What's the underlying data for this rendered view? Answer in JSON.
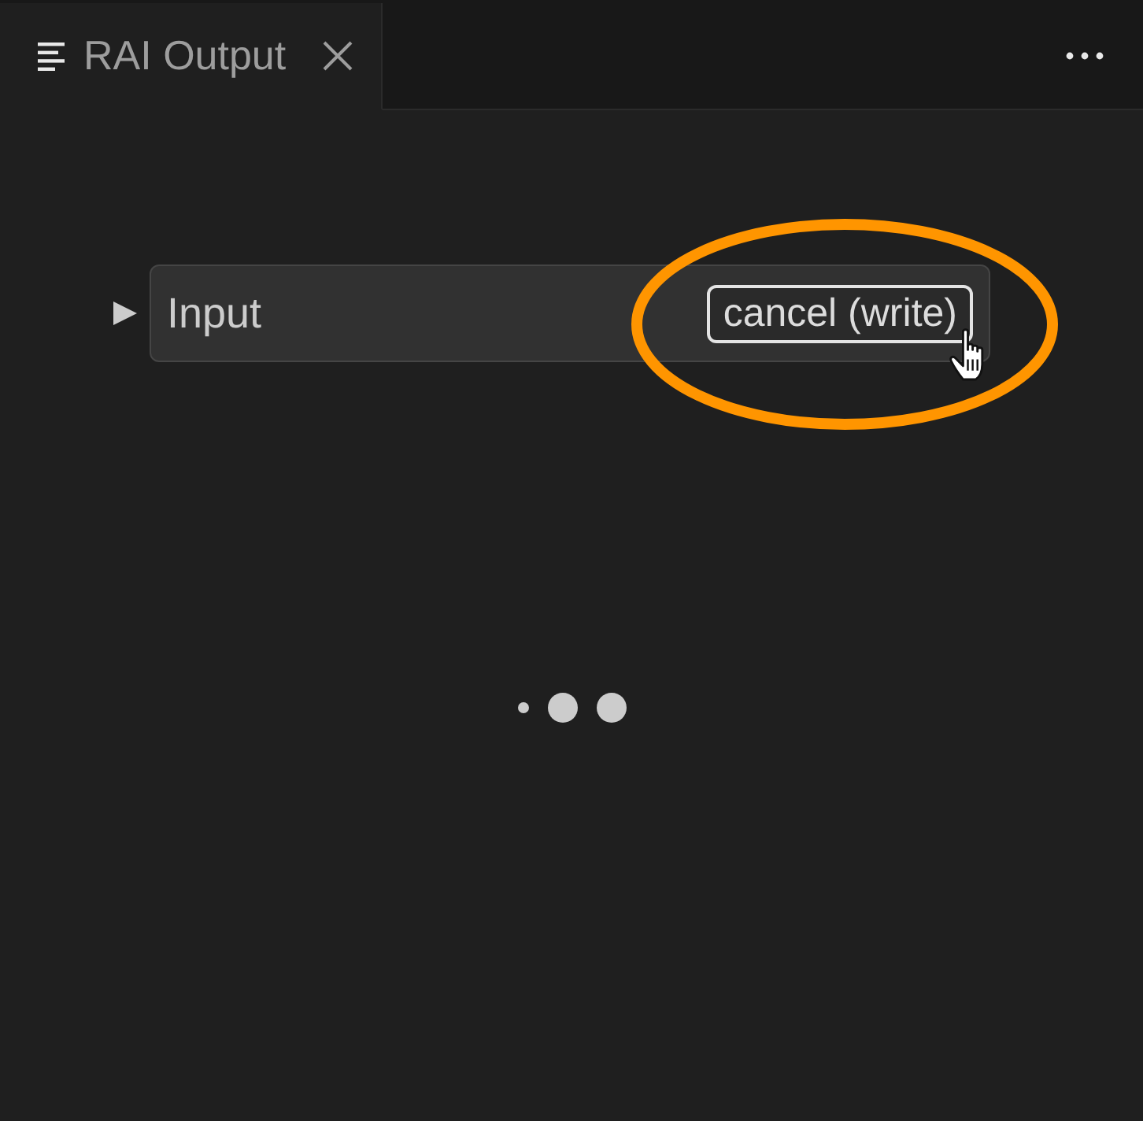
{
  "tabs": [
    {
      "label": "RAI Output",
      "selected": true,
      "closable": true
    }
  ],
  "cells": [
    {
      "title": "Input",
      "expanded": false,
      "actions": [
        {
          "label": "cancel (write)",
          "highlighted": true,
          "hovered": true
        }
      ]
    }
  ],
  "loading": true
}
